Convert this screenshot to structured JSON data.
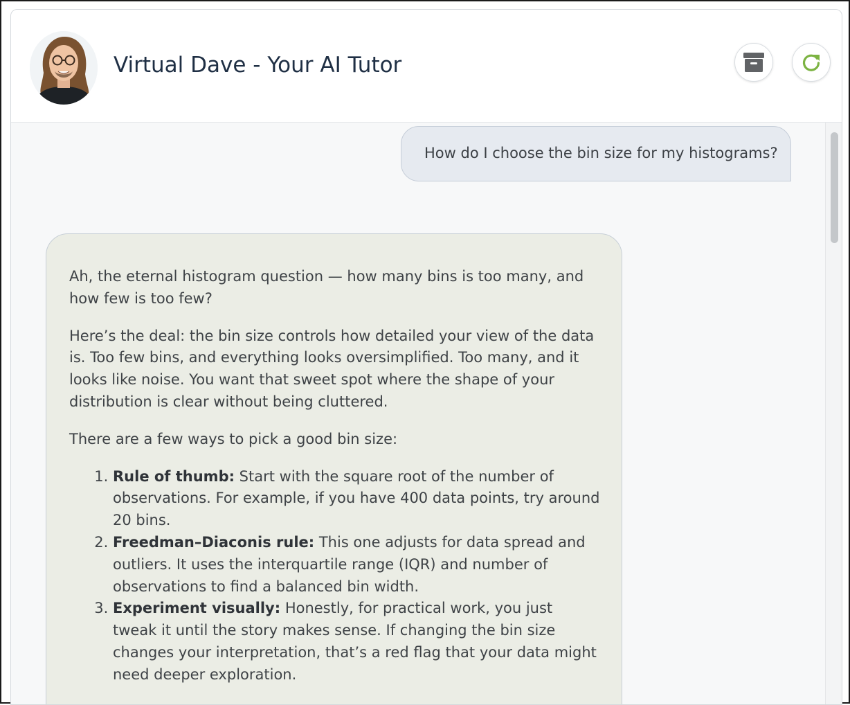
{
  "header": {
    "title": "Virtual Dave - Your AI Tutor",
    "avatar_icon": "tutor-avatar-photo",
    "archive_icon": "archive-box-icon",
    "refresh_icon": "refresh-icon",
    "accent_color": "#7cb342"
  },
  "messages": {
    "user": {
      "text": "How do I choose the bin size for my histograms?"
    },
    "bot": {
      "para1": "Ah, the eternal histogram question — how many bins is too many, and how few is too few?",
      "para2": "Here’s the deal: the bin size controls how detailed your view of the data is. Too few bins, and everything looks oversimplified. Too many, and it looks like noise. You want that sweet spot where the shape of your distribution is clear without being cluttered.",
      "para3": "There are a few ways to pick a good bin size:",
      "items": [
        {
          "lead": "Rule of thumb:",
          "text": " Start with the square root of the number of observations. For example, if you have 400 data points, try around 20 bins."
        },
        {
          "lead": "Freedman–Diaconis rule:",
          "text": " This one adjusts for data spread and outliers. It uses the interquartile range (IQR) and number of observations to find a balanced bin width."
        },
        {
          "lead": "Experiment visually:",
          "text": " Honestly, for practical work, you just tweak it until the story makes sense. If changing the bin size changes your interpretation, that’s a red flag that your data might need deeper exploration."
        }
      ]
    }
  }
}
